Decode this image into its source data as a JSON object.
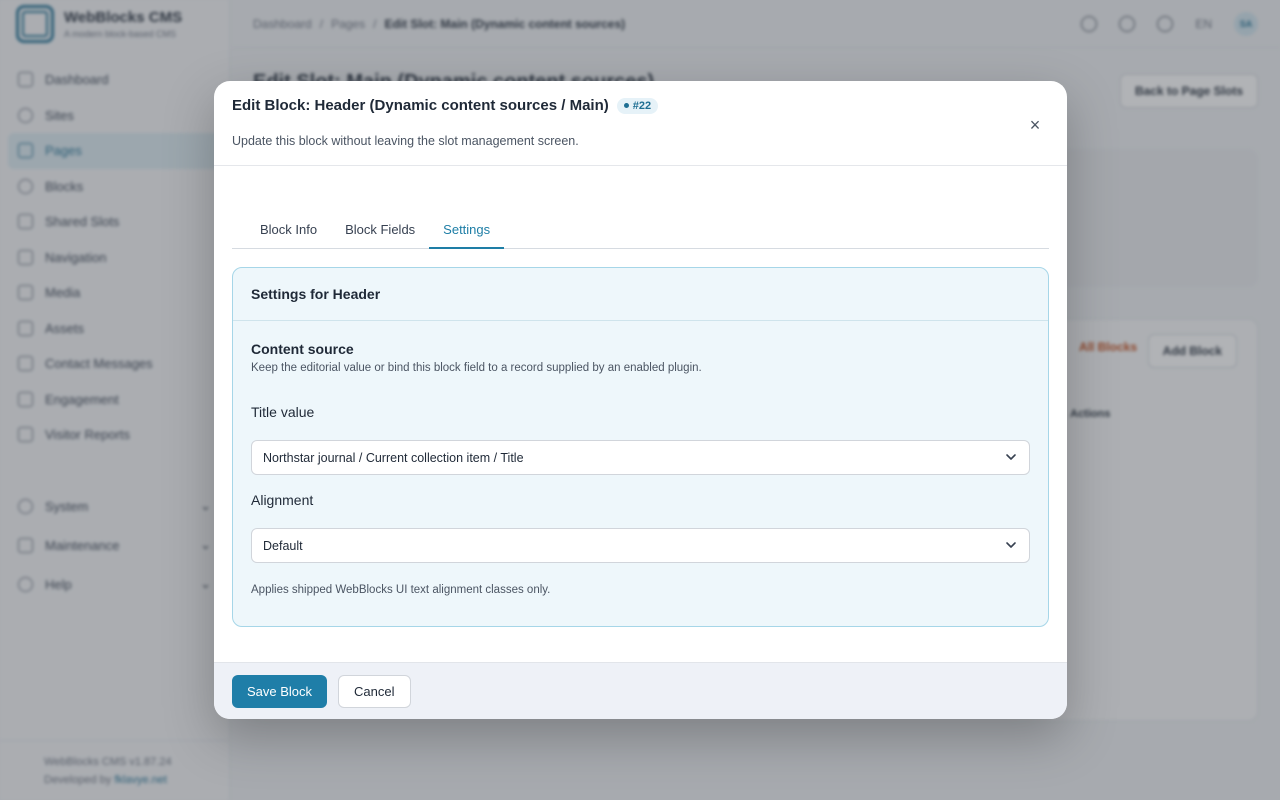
{
  "app": {
    "brand_name": "WebBlocks CMS",
    "brand_tagline": "A modern block-based CMS",
    "nav": [
      {
        "label": "Dashboard",
        "icon": "dashboard-icon"
      },
      {
        "label": "Sites",
        "icon": "globe-icon"
      },
      {
        "label": "Pages",
        "icon": "pages-icon",
        "active": true
      },
      {
        "label": "Blocks",
        "icon": "blocks-icon"
      },
      {
        "label": "Shared Slots",
        "icon": "layers-icon"
      },
      {
        "label": "Navigation",
        "icon": "menu-icon"
      },
      {
        "label": "Media",
        "icon": "image-icon"
      },
      {
        "label": "Assets",
        "icon": "code-icon"
      },
      {
        "label": "Contact Messages",
        "icon": "mail-icon"
      },
      {
        "label": "Engagement",
        "icon": "star-icon"
      },
      {
        "label": "Visitor Reports",
        "icon": "chart-icon"
      }
    ],
    "nav_groups": [
      {
        "label": "System",
        "icon": "gear-icon"
      },
      {
        "label": "Maintenance",
        "icon": "document-icon"
      },
      {
        "label": "Help",
        "icon": "help-icon"
      }
    ],
    "footer_version": "WebBlocks CMS v1.87.24",
    "footer_dev_prefix": "Developed by",
    "footer_dev_link": "fklavye.net",
    "breadcrumb": [
      "Dashboard",
      "Pages",
      "Edit Slot: Main (Dynamic content sources)"
    ],
    "lang": "EN",
    "avatar_initials": "SA",
    "page_title": "Edit Slot: Main (Dynamic content sources)",
    "back_button": "Back to Page Slots",
    "delete_all": "All Blocks",
    "add_block": "Add Block",
    "table_actions_header": "Actions"
  },
  "modal": {
    "title": "Edit Block: Header (Dynamic content sources / Main)",
    "badge": "#22",
    "subtitle": "Update this block without leaving the slot management screen.",
    "close_label": "×",
    "tabs": [
      {
        "label": "Block Info",
        "active": false
      },
      {
        "label": "Block Fields",
        "active": false
      },
      {
        "label": "Settings",
        "active": true
      }
    ],
    "settings": {
      "header": "Settings for Header",
      "section_title": "Content source",
      "section_desc": "Keep the editorial value or bind this block field to a record supplied by an enabled plugin.",
      "title_label": "Title value",
      "title_value": "Northstar journal / Current collection item / Title",
      "alignment_label": "Alignment",
      "alignment_value": "Default",
      "hint": "Applies shipped WebBlocks UI text alignment classes only."
    },
    "footer": {
      "save": "Save Block",
      "cancel": "Cancel"
    }
  },
  "colors": {
    "accent": "#1f7ea8",
    "settings_bg": "#eef7fb",
    "settings_border": "#a6d6e8"
  }
}
